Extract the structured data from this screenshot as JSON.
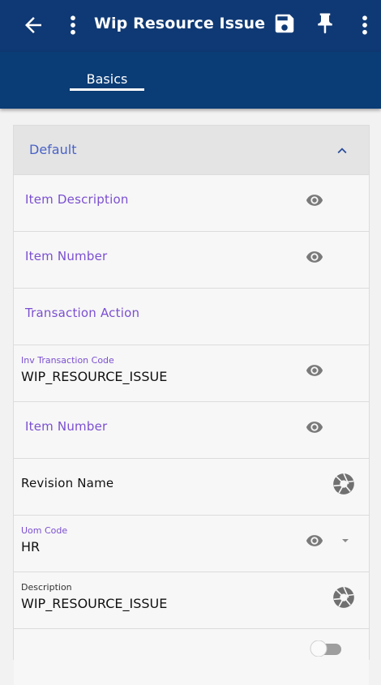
{
  "header": {
    "title": "Wip Resource Issue",
    "icons": [
      "arrow-back-icon",
      "more-vert-icon",
      "save-icon",
      "pin-icon",
      "more-vert-icon"
    ]
  },
  "tabs": [
    {
      "label": "Basics",
      "active": true
    }
  ],
  "section": {
    "label": "Default",
    "expanded": true
  },
  "rows": [
    {
      "label": "Item Description",
      "icon": "eye-icon"
    },
    {
      "label": "Item Number",
      "icon": "eye-icon"
    },
    {
      "label": "Transaction Action"
    },
    {
      "label": "Inv Transaction Code",
      "value": "WIP_RESOURCE_ISSUE",
      "icon": "eye-icon"
    },
    {
      "label": "Item Number",
      "icon": "eye-icon"
    },
    {
      "label": "Revision Name",
      "icon": "aperture-icon"
    },
    {
      "label": "Uom Code",
      "value": "HR",
      "icon": "eye-icon",
      "dropdown": true
    },
    {
      "label": "Description",
      "value": "WIP_RESOURCE_ISSUE",
      "icon": "aperture-icon"
    }
  ],
  "colors": {
    "appbar": "#0f3974",
    "tabbar": "#0a3c75",
    "field_label": "#7b4fd1",
    "section_label": "#4a63c7"
  }
}
